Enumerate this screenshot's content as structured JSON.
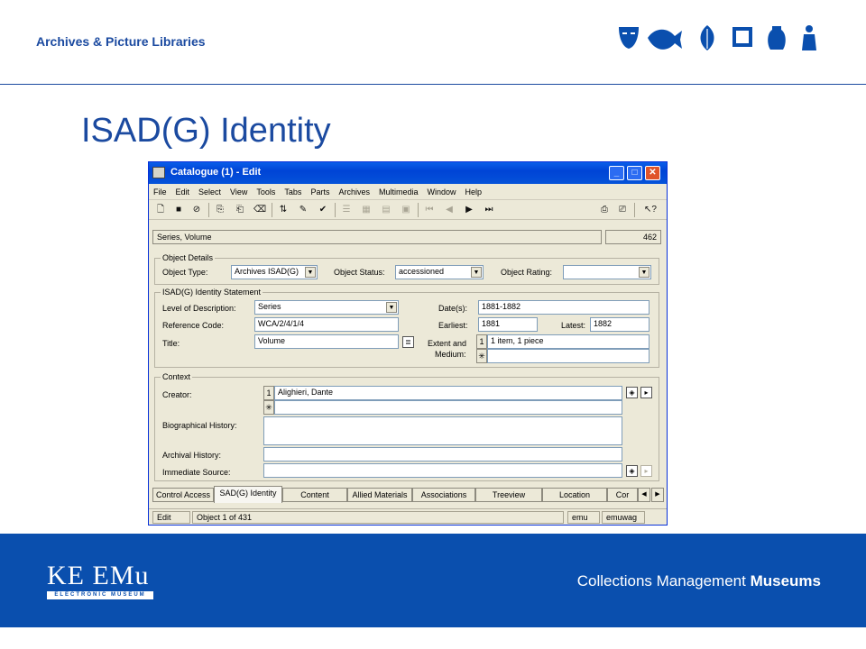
{
  "slide": {
    "brand": "Archives & Picture Libraries",
    "title": "ISAD(G) Identity",
    "footer_logo": "KE EMu",
    "footer_logo_sub": "ELECTRONIC MUSEUM",
    "tagline_light": "Collections Management ",
    "tagline_bold": "Museums",
    "header_icons": [
      "mask-icon",
      "fish-icon",
      "leaf-icon",
      "frame-icon",
      "vase-icon",
      "figure-icon"
    ]
  },
  "window": {
    "title": "Catalogue (1) - Edit",
    "menu": [
      "File",
      "Edit",
      "Select",
      "View",
      "Tools",
      "Tabs",
      "Parts",
      "Archives",
      "Multimedia",
      "Window",
      "Help"
    ],
    "summary": "Series, Volume",
    "record_count": "462",
    "object_details": {
      "legend": "Object Details",
      "type_label": "Object Type:",
      "type_value": "Archives ISAD(G)",
      "status_label": "Object Status:",
      "status_value": "accessioned",
      "rating_label": "Object Rating:",
      "rating_value": ""
    },
    "identity": {
      "legend": "ISAD(G) Identity Statement",
      "level_label": "Level of Description:",
      "level_value": "Series",
      "refcode_label": "Reference Code:",
      "refcode_value": "WCA/2/4/1/4",
      "title_label": "Title:",
      "title_value": "Volume",
      "dates_label": "Date(s):",
      "dates_value": "1881-1882",
      "earliest_label": "Earliest:",
      "earliest_value": "1881",
      "latest_label": "Latest:",
      "latest_value": "1882",
      "extent_label_1": "Extent and",
      "extent_label_2": "Medium:",
      "extent_row_num": "1",
      "extent_value": "1 item, 1 piece",
      "new_row_marker": "✳"
    },
    "context": {
      "legend": "Context",
      "creator_label": "Creator:",
      "creator_row_num": "1",
      "creator_value": "Alighieri, Dante",
      "new_row_marker": "✳",
      "biohist_label": "Biographical History:",
      "biohist_value": "",
      "archhist_label": "Archival History:",
      "archhist_value": "",
      "source_label": "Immediate Source:",
      "source_value": ""
    },
    "tabs": [
      "Control Access",
      "SAD(G) Identity",
      "Content",
      "Allied Materials",
      "Associations",
      "Treeview",
      "Location",
      "Cor"
    ],
    "active_tab": "SAD(G) Identity",
    "status_bar": {
      "mode": "Edit",
      "position": "Object 1 of 431",
      "app": "emu",
      "user": "emuwag"
    }
  }
}
